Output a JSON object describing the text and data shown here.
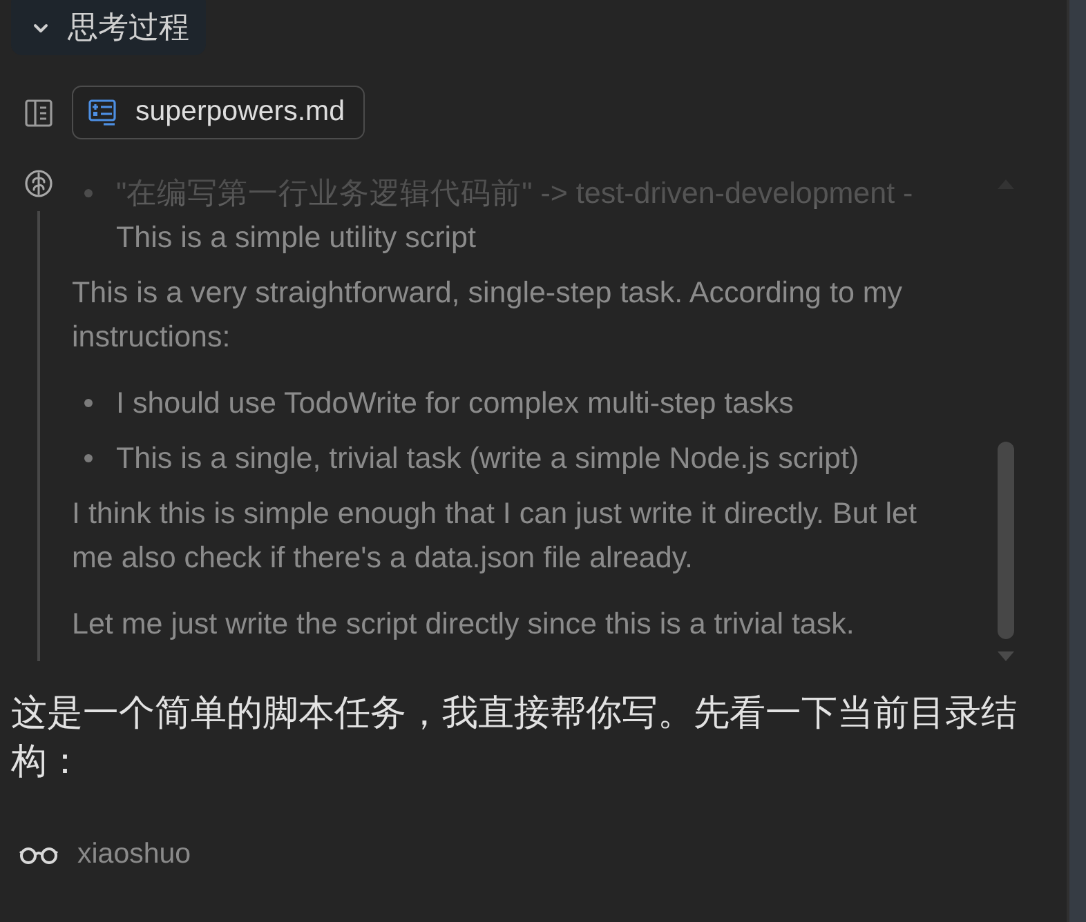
{
  "thinking": {
    "title": "思考过程",
    "expanded": true,
    "attachment": {
      "label": "superpowers.md"
    },
    "content": [
      {
        "kind": "bullet",
        "text": "\"在编写第一行业务逻辑代码前\" -> test-driven-development - This is a simple utility script"
      },
      {
        "kind": "paragraph",
        "text": "This is a very straightforward, single-step task. According to my instructions:"
      },
      {
        "kind": "bullet",
        "text": "I should use TodoWrite for complex multi-step tasks"
      },
      {
        "kind": "bullet",
        "text": "This is a single, trivial task (write a simple Node.js script)"
      },
      {
        "kind": "paragraph",
        "text": "I think this is simple enough that I can just write it directly. But let me also check if there's a data.json file already."
      },
      {
        "kind": "paragraph",
        "text": "Let me just write the script directly since this is a trivial task."
      }
    ]
  },
  "response": {
    "text": "这是一个简单的脚本任务，我直接帮你写。先看一下当前目录结构："
  },
  "tool_call": {
    "label": "xiaoshuo"
  }
}
